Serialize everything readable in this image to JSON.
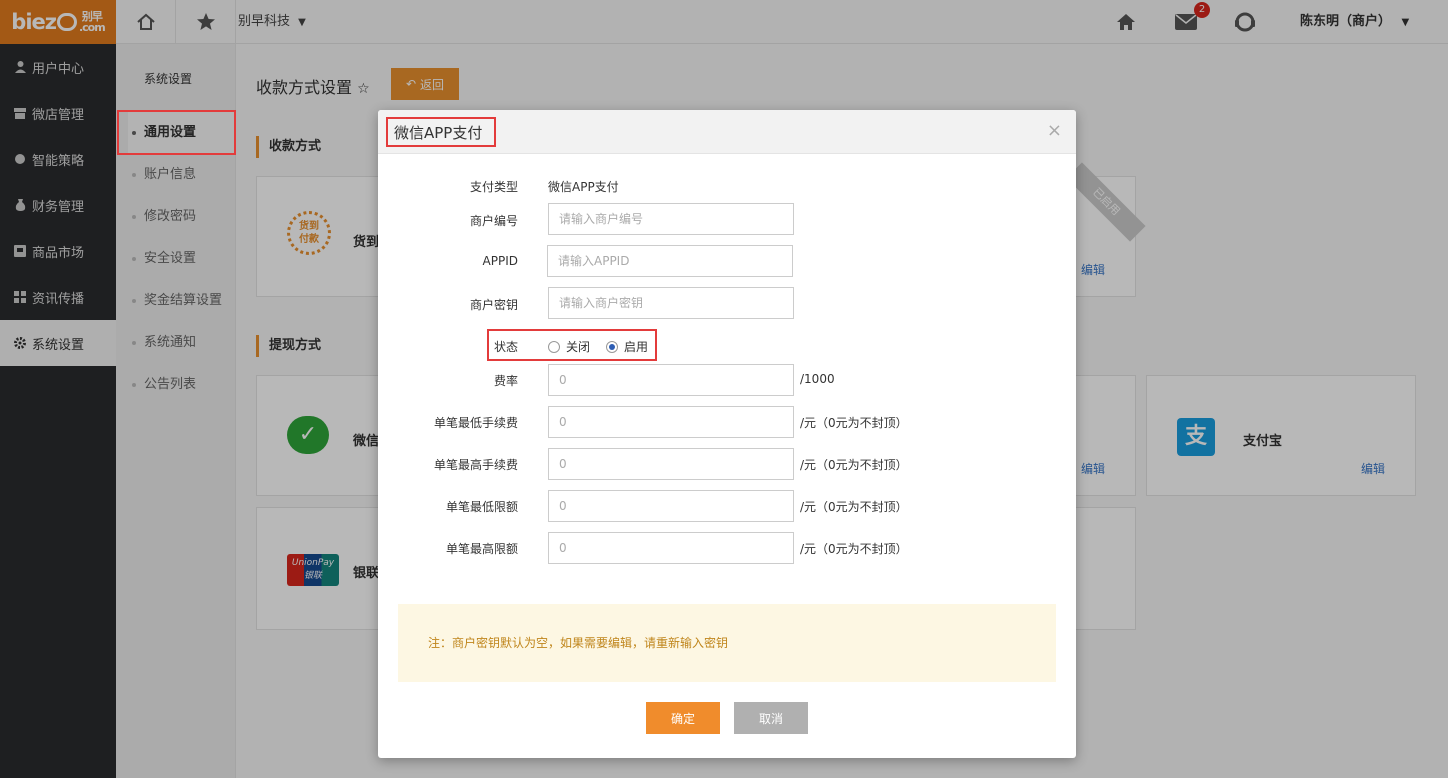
{
  "topbar": {
    "logo_text": "biez",
    "logo_cn_1": "别早",
    "logo_cn_2": ".com",
    "company": "别早科技",
    "mail_count": "2",
    "user": "陈东明（商户）"
  },
  "sidebar": {
    "items": [
      {
        "label": "用户中心"
      },
      {
        "label": "微店管理"
      },
      {
        "label": "智能策略"
      },
      {
        "label": "财务管理"
      },
      {
        "label": "商品市场"
      },
      {
        "label": "资讯传播"
      },
      {
        "label": "系统设置"
      }
    ]
  },
  "subnav": {
    "title": "系统设置",
    "items": [
      {
        "label": "通用设置"
      },
      {
        "label": "账户信息"
      },
      {
        "label": "修改密码"
      },
      {
        "label": "安全设置"
      },
      {
        "label": "奖金结算设置"
      },
      {
        "label": "系统通知"
      },
      {
        "label": "公告列表"
      }
    ]
  },
  "main": {
    "page_title": "收款方式设置",
    "back_label": "返回",
    "section_pay": "收款方式",
    "section_withdraw": "提现方式",
    "cards": {
      "cod_name": "货到",
      "cod_logo_1": "货到",
      "cod_logo_2": "付款",
      "wechat_name": "微信",
      "unionpay_name": "银联",
      "unionpay_logo": "UnionPay",
      "unionpay_logo_cn": "银联",
      "alipay_name": "支付宝",
      "ribbon": "已启用",
      "edit": "编辑"
    }
  },
  "modal": {
    "title": "微信APP支付",
    "close": "×",
    "pay_type_label": "支付类型",
    "pay_type_value": "微信APP支付",
    "merchant_no_label": "商户编号",
    "merchant_no_placeholder": "请输入商户编号",
    "appid_label": "APPID",
    "appid_placeholder": "请输入APPID",
    "secret_label": "商户密钥",
    "secret_placeholder": "请输入商户密钥",
    "status_label": "状态",
    "status_off": "关闭",
    "status_on": "启用",
    "rate_label": "费率",
    "rate_value": "0",
    "rate_suffix": "/1000",
    "min_fee_label": "单笔最低手续费",
    "min_fee_value": "0",
    "max_fee_label": "单笔最高手续费",
    "max_fee_value": "0",
    "min_limit_label": "单笔最低限额",
    "min_limit_value": "0",
    "max_limit_label": "单笔最高限额",
    "max_limit_value": "0",
    "amount_suffix": "/元（0元为不封顶）",
    "note": "注：商户密钥默认为空，如果需要编辑，请重新输入密钥",
    "ok_label": "确定",
    "cancel_label": "取消"
  },
  "colors": {
    "accent": "#e9902e",
    "highlight_box": "#e33b3b",
    "sidebar_bg": "#2a2b2e",
    "link": "#3775c7"
  }
}
